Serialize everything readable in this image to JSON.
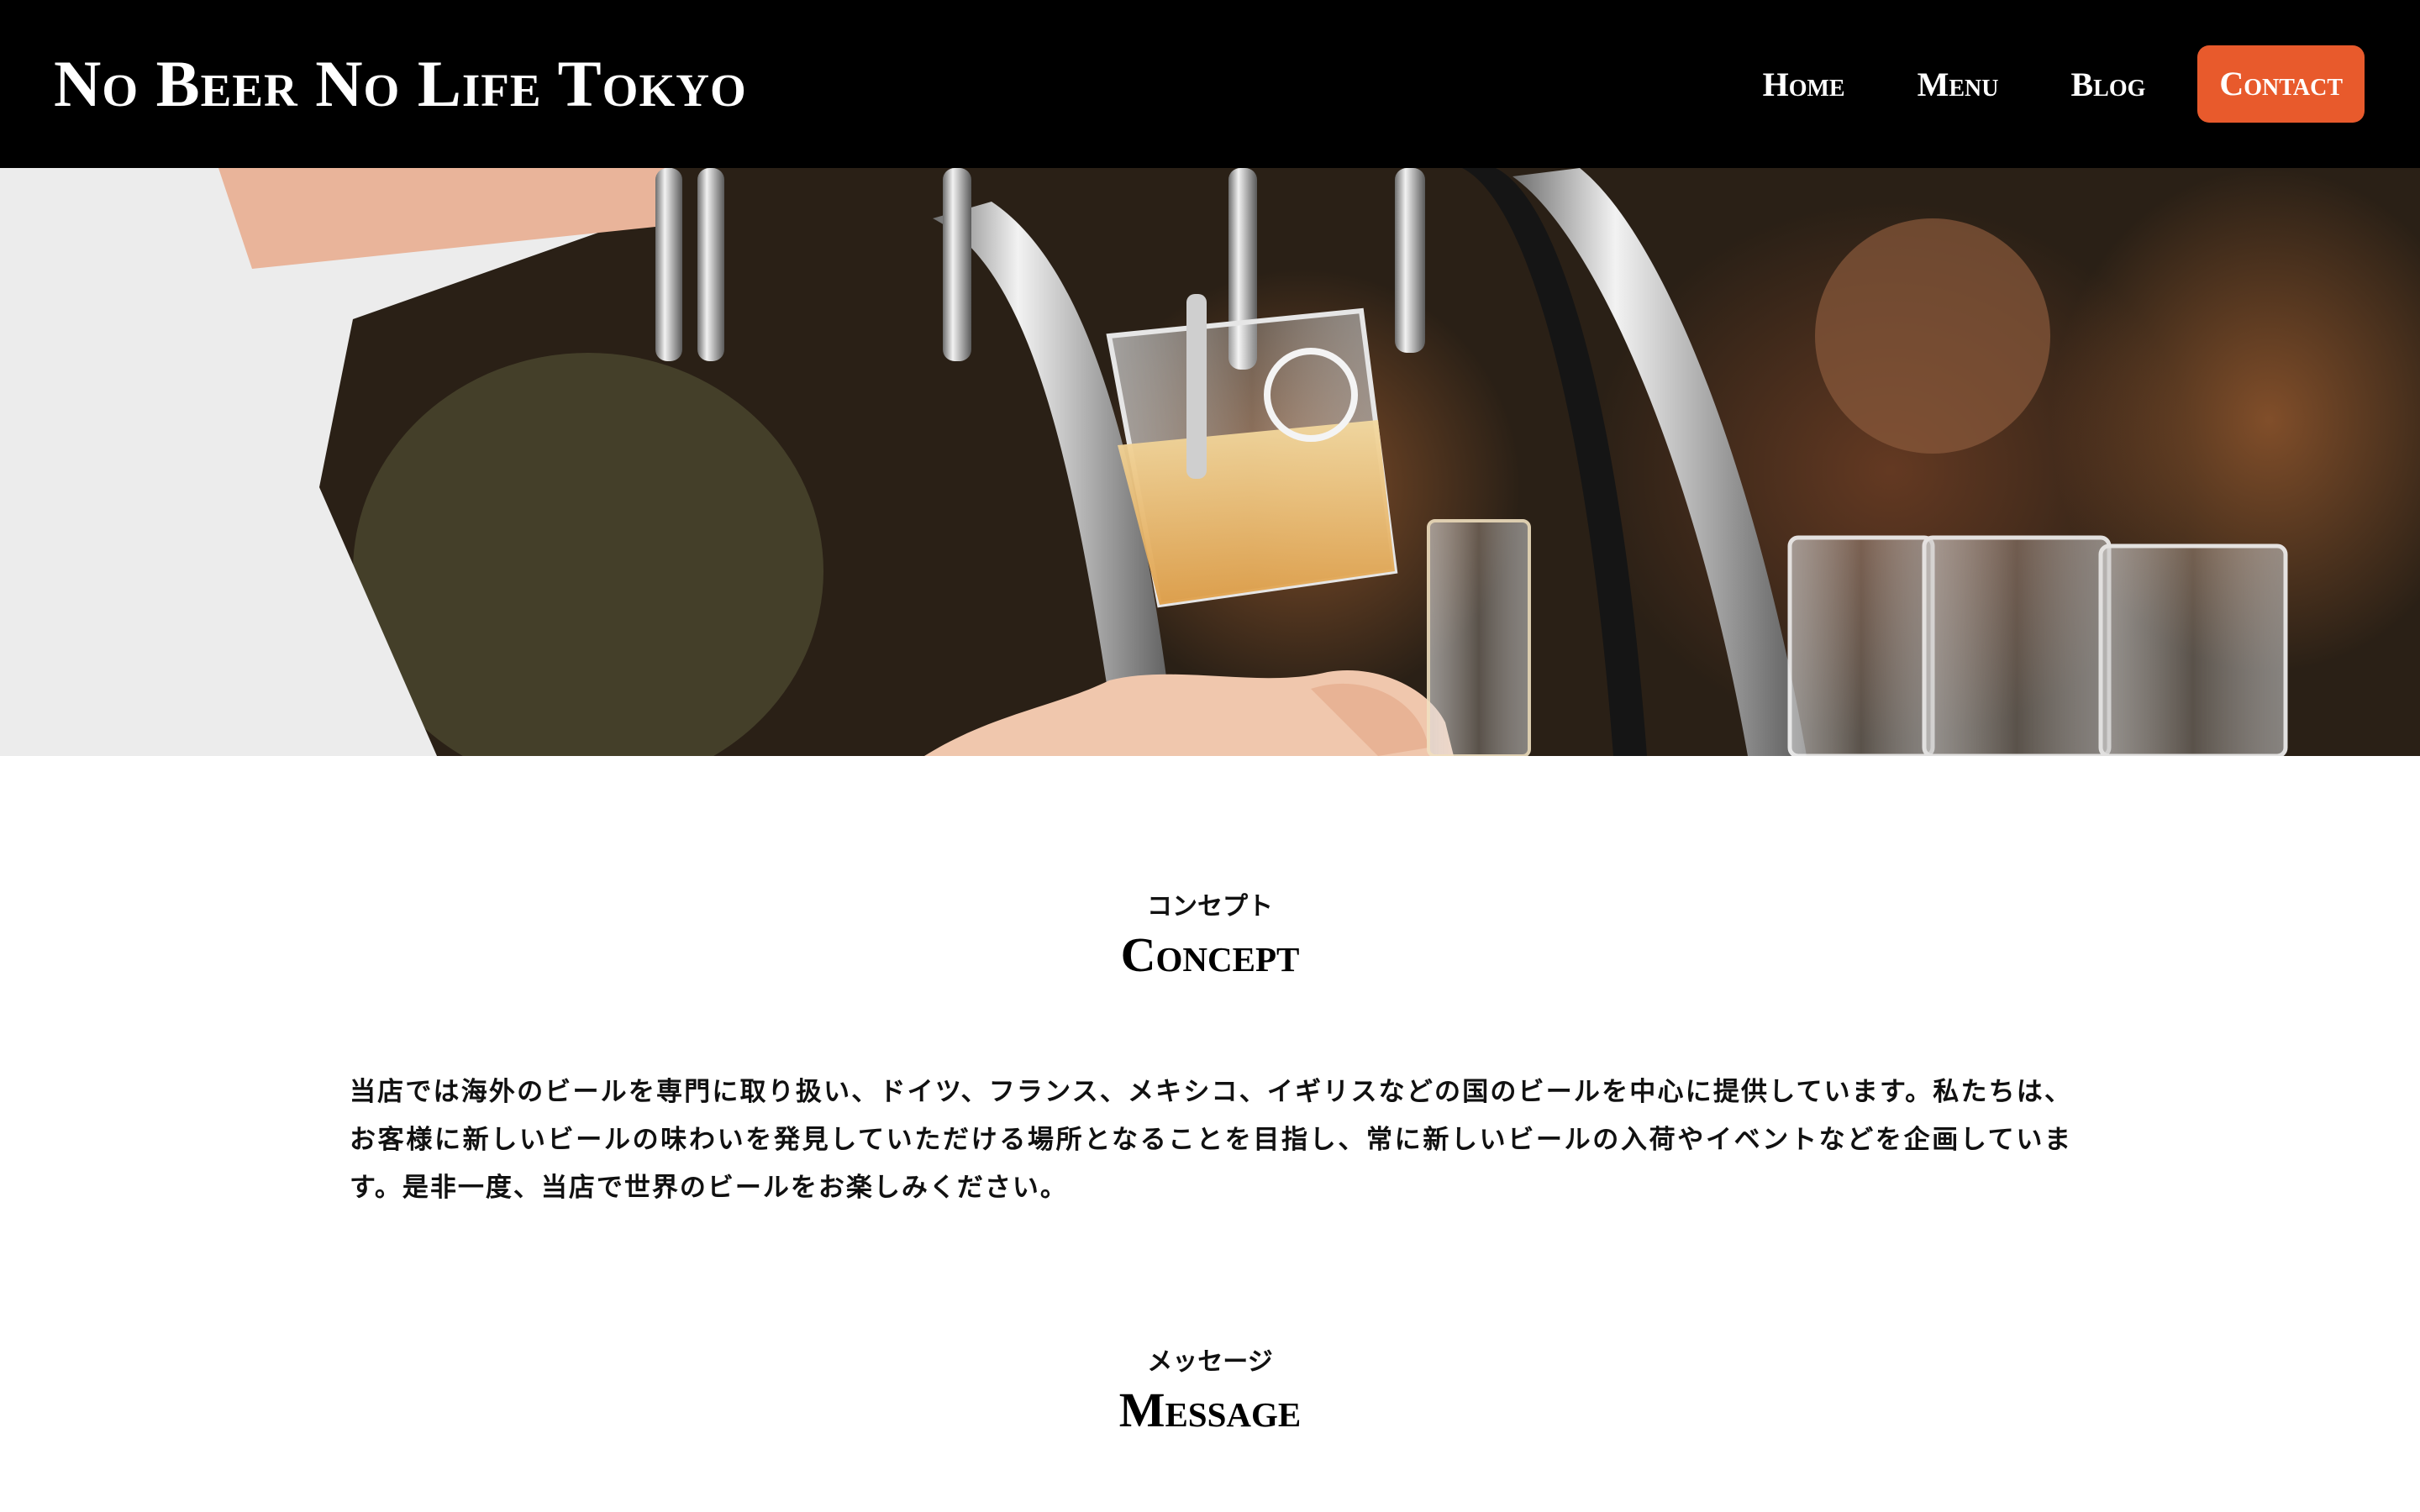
{
  "header": {
    "logo": "No Beer No Life Tokyo",
    "nav": [
      {
        "label": "Home"
      },
      {
        "label": "Menu"
      },
      {
        "label": "Blog"
      }
    ],
    "contact_label": "Contact",
    "accent_color": "#e85a2c"
  },
  "hero": {
    "image": "beer-tap-pouring-photo"
  },
  "concept": {
    "kicker": "コンセプト",
    "title": "Concept",
    "body": "当店では海外のビールを専門に取り扱い、ドイツ、フランス、メキシコ、イギリスなどの国のビールを中心に提供しています。私たちは、お客様に新しいビールの味わいを発見していただける場所となることを目指し、常に新しいビールの入荷やイベントなどを企画しています。是非一度、当店で世界のビールをお楽しみください。"
  },
  "message": {
    "kicker": "メッセージ",
    "title": "Message"
  }
}
